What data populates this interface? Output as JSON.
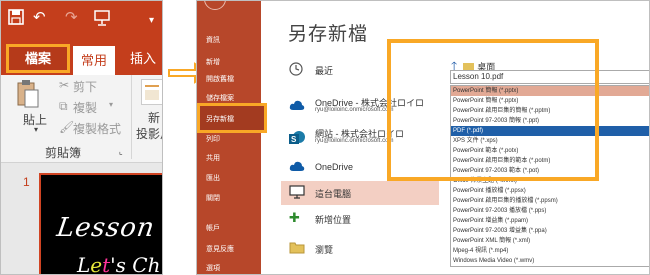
{
  "powerpoint": {
    "qat": {
      "save_icon": "save-icon",
      "undo_icon": "undo-icon",
      "redo_icon": "redo-icon",
      "slideshow_icon": "slideshow-icon",
      "more_icon": "customize-qat-icon",
      "undo_glyph": "↶",
      "redo_glyph": "↷",
      "more_glyph": "▾"
    },
    "tabs": {
      "file": "檔案",
      "home": "常用",
      "insert": "插入"
    },
    "ribbon": {
      "paste": "貼上",
      "cut": "剪下",
      "copy": "複製",
      "copy_arrow": "▾",
      "format_painter": "複製格式",
      "new": "新",
      "new_slide": "投影片",
      "group_label": "剪貼簿",
      "launcher": "⌞"
    },
    "slide": {
      "number": "1",
      "title_line1": "Lesson",
      "title_line2_a": "L",
      "title_line2_b": "e",
      "title_line2_c": "t",
      "title_line2_d": "'s Ch"
    },
    "colors": {
      "accent": "#c43e1c",
      "highlight": "#f9a826"
    }
  },
  "backstage": {
    "nav": [
      "資訊",
      "新增",
      "開啟舊檔",
      "儲存檔案",
      "另存新檔",
      "列印",
      "共用",
      "匯出",
      "關閉",
      "帳戶",
      "意見反應",
      "選項"
    ],
    "nav_selected": "另存新檔",
    "heading": "另存新檔",
    "locations": [
      {
        "icon": "clock-icon",
        "name": "最近",
        "email": ""
      },
      {
        "icon": "cloud-icon",
        "name": "OneDrive - 株式会社ロイロ",
        "email": "ryu@loiloinc.onmicrosoft.com"
      },
      {
        "icon": "sharepoint-icon",
        "name": "網站 - 株式会社ロイロ",
        "email": "ryu@loiloinc.onmicrosoft.com"
      },
      {
        "icon": "cloud-icon",
        "name": "OneDrive",
        "email": ""
      },
      {
        "icon": "computer-icon",
        "name": "這台電腦",
        "email": ""
      },
      {
        "icon": "add-location-icon",
        "name": "新增位置",
        "email": ""
      },
      {
        "icon": "folder-icon",
        "name": "瀏覽",
        "email": ""
      }
    ],
    "browse": {
      "path": "桌面",
      "up_glyph": "🡑",
      "filename": "Lesson 10.pdf",
      "filetypes": [
        "PowerPoint 簡報 (*.pptx)",
        "PowerPoint 簡報 (*.pptx)",
        "PowerPoint 啟用巨集的簡報 (*.pptm)",
        "PowerPoint 97-2003 簡報 (*.ppt)",
        "PDF (*.pdf)",
        "XPS 文件 (*.xps)",
        "PowerPoint 範本 (*.potx)",
        "PowerPoint 啟用巨集的範本 (*.potm)",
        "PowerPoint 97-2003 範本 (*.pot)",
        "Office 佈景主題 (*.thmx)",
        "PowerPoint 播放檔 (*.ppsx)",
        "PowerPoint 啟用巨集的播放檔 (*.ppsm)",
        "PowerPoint 97-2003 播放檔 (*.pps)",
        "PowerPoint 增益集 (*.ppam)",
        "PowerPoint 97-2003 增益集 (*.ppa)",
        "PowerPoint XML 簡報 (*.xml)",
        "Mpeg-4 視訊 (*.mp4)",
        "Windows Media Video (*.wmv)"
      ],
      "selected_filetype": "PDF (*.pdf)"
    }
  }
}
